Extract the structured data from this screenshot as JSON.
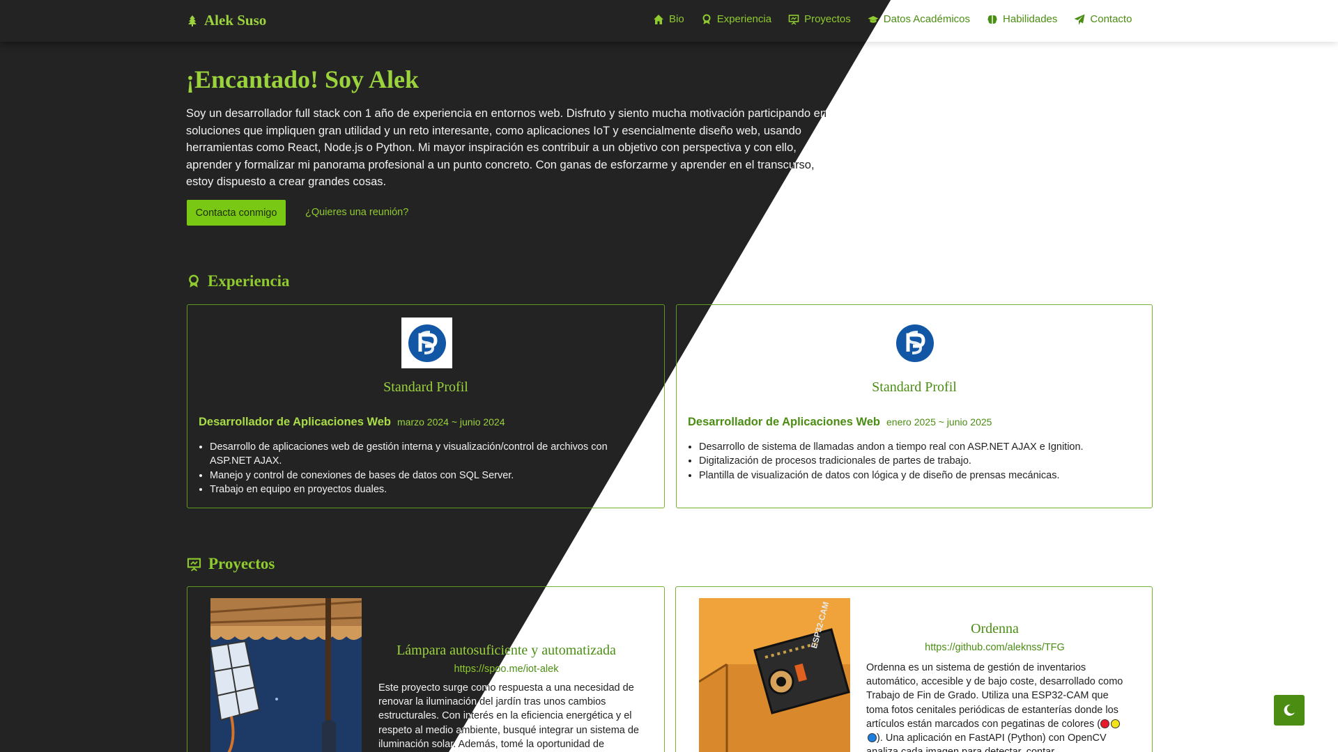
{
  "brand": {
    "name": "Alek Suso",
    "icon": "tree-icon"
  },
  "nav": [
    {
      "label": "Bio",
      "icon": "home-icon"
    },
    {
      "label": "Experiencia",
      "icon": "award-icon"
    },
    {
      "label": "Proyectos",
      "icon": "presentation-icon"
    },
    {
      "label": "Datos Académicos",
      "icon": "graduation-cap-icon"
    },
    {
      "label": "Habilidades",
      "icon": "brain-icon"
    },
    {
      "label": "Contacto",
      "icon": "paper-plane-icon"
    }
  ],
  "hero": {
    "title": "¡Encantado! Soy Alek",
    "text": "Soy un desarrollador full stack con 1 año de experiencia en entornos web. Disfruto y siento mucha motivación participando en soluciones que impliquen gran utilidad y un reto interesante, como aplicaciones IoT y esencialmente diseño web, usando herramientas como React, Node.js o Python. Mi mayor inspiración es contribuir a un objetivo con perspectiva y con ello, aprender y formalizar mi panorama profesional a un punto concreto. Con ganas de esforzarme y aprender en el transcurso, estoy dispuesto a crear grandes cosas.",
    "cta": "Contacta conmigo",
    "meeting": "¿Quieres una reunión?"
  },
  "experience": {
    "title": "Experiencia",
    "items": [
      {
        "company": "Standard Profil",
        "role": "Desarrollador de Aplicaciones Web",
        "dates": "marzo 2024 ~ junio 2024",
        "bullets": [
          "Desarrollo de aplicaciones web de gestión interna y visualización/control de archivos con ASP.NET AJAX.",
          "Manejo y control de conexiones de bases de datos con SQL Server.",
          "Trabajo en equipo en proyectos duales."
        ]
      },
      {
        "company": "Standard Profil",
        "role": "Desarrollador de Aplicaciones Web",
        "dates": "enero 2025 ~ junio 2025",
        "bullets": [
          "Desarrollo de sistema de llamadas andon a tiempo real con ASP.NET AJAX e Ignition.",
          "Digitalización de procesos tradicionales de partes de trabajo.",
          "Plantilla de visualización de datos con lógica y de diseño de prensas mecánicas."
        ]
      }
    ]
  },
  "projects": {
    "title": "Proyectos",
    "items": [
      {
        "title": "Lámpara autosuficiente y automatizada",
        "link": "https://spoo.me/iot-alek",
        "text": "Este proyecto surge como respuesta a una necesidad de renovar la iluminación del jardín tras unos cambios estructurales. Con interés en la eficiencia energética y el respeto al medio ambiente, busqué integrar un sistema de iluminación solar. Además, tomé la oportunidad de"
      },
      {
        "title": "Ordenna",
        "link": "https://github.com/aleknss/TFG",
        "text_before": "Ordenna es un sistema de gestión de inventarios automático, accesible y de bajo coste, desarrollado como Trabajo de Fin de Grado. Utiliza una ESP32-CAM que toma fotos cenitales periódicas de estanterías donde los artículos están marcados con pegatinas de colores (",
        "text_after": "). Una aplicación en FastAPI (Python) con OpenCV analiza cada imagen para detectar, contar",
        "dot_colors": [
          "#e8192c",
          "#f2e21a",
          "#1c7fe0"
        ],
        "chip_label": "ESP32-CAM"
      }
    ]
  },
  "theme_toggle": {
    "icon": "moon-icon"
  },
  "colors": {
    "accent_dark": "#8fcb2e",
    "accent_light": "#4a8d12",
    "dark_bg": "#232323",
    "button": "#79c813"
  }
}
